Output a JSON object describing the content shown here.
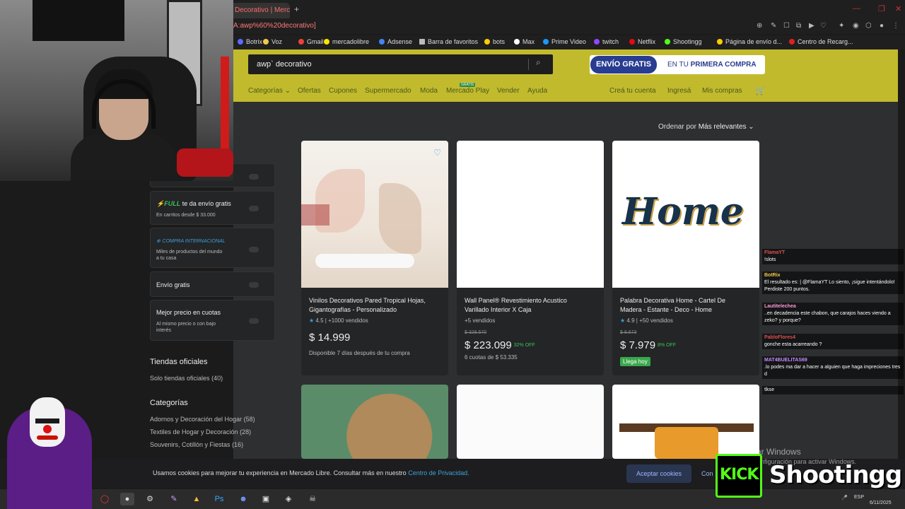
{
  "browser": {
    "tab_title": "Decorativo | Mercado",
    "new_tab": "+",
    "address": "A:awp%60%20decorativo]",
    "bookmarks": [
      {
        "label": "Botrix",
        "color": "#5b6cff"
      },
      {
        "label": "Voz",
        "color": "#f2c94c"
      },
      {
        "label": "Gmail",
        "color": "#ea4335"
      },
      {
        "label": "mercadolibre",
        "color": "#ffe600"
      },
      {
        "label": "Adsense",
        "color": "#4285f4"
      },
      {
        "label": "Barra de favoritos",
        "color": "#bbbbbb"
      },
      {
        "label": "bots",
        "color": "#ffcc00"
      },
      {
        "label": "Max",
        "color": "#ffffff"
      },
      {
        "label": "Prime Video",
        "color": "#1a98ff"
      },
      {
        "label": "twitch",
        "color": "#9146ff"
      },
      {
        "label": "Netflix",
        "color": "#e50914"
      },
      {
        "label": "Shootingg",
        "color": "#53fc18"
      },
      {
        "label": "Página de envío d...",
        "color": "#ffcc00"
      },
      {
        "label": "Centro de Recarg...",
        "color": "#e02020"
      }
    ]
  },
  "ml": {
    "search_value": "awp` decorativo",
    "promo_badge": "ENVÍO GRATIS",
    "promo_text_prefix": "EN TU",
    "promo_text_bold": "PRIMERA COMPRA",
    "nav": {
      "categorias": "Categorías",
      "ofertas": "Ofertas",
      "cupones": "Cupones",
      "supermercado": "Supermercado",
      "moda": "Moda",
      "mercado_play": "Mercado Play",
      "gratis_tag": "GRATIS",
      "vender": "Vender",
      "ayuda": "Ayuda",
      "crea_cuenta": "Creá tu cuenta",
      "ingresa": "Ingresá",
      "mis_compras": "Mis compras"
    },
    "sort_label": "Ordenar por",
    "sort_value": "Más relevantes"
  },
  "sidebar": {
    "full_label": "FULL",
    "full_title": "te da envío gratis",
    "full_sub": "En carritos desde $ 33.000",
    "intl_label": "COMPRA INTERNACIONAL",
    "intl_sub1": "Miles de productos del mundo",
    "intl_sub2": "a tu casa",
    "envio_gratis": "Envío gratis",
    "cuotas_title": "Mejor precio en cuotas",
    "cuotas_sub1": "Al mismo precio o con bajo",
    "cuotas_sub2": "interés",
    "tiendas_heading": "Tiendas oficiales",
    "tiendas_item": "Solo tiendas oficiales",
    "tiendas_count": "(40)",
    "categorias_heading": "Categorías",
    "categorias": [
      {
        "label": "Adornos y Decoración del Hogar",
        "count": "(58)"
      },
      {
        "label": "Textiles de Hogar y Decoración",
        "count": "(28)"
      },
      {
        "label": "Souvenirs, Cotillón y Fiestas",
        "count": "(16)"
      }
    ]
  },
  "products": [
    {
      "title1": "Vinilos Decorativos Pared Tropical Hojas,",
      "title2": "Gigantografías - Personalizado",
      "rating": "4.5",
      "sold": "| +1000 vendidos",
      "price": "$ 14.999",
      "sub": "Disponible 7 días después de tu compra"
    },
    {
      "title1": "Wall Panel® Revestimiento Acustico",
      "title2": "Varillado Interior X Caja",
      "sold": "+5 vendidos",
      "old_price": "$ 328.570",
      "price": "$ 223.099",
      "off": "32% OFF",
      "sub": "6 cuotas de $ 53.335"
    },
    {
      "title1": "Palabra Decorativa Home - Cartel De",
      "title2": "Madera - Estante - Deco - Home",
      "rating": "4.9",
      "sold": "| +50 vendidos",
      "old_price": "$ 8.673",
      "price": "$ 7.979",
      "off": "8% OFF",
      "badge": "Llega hoy",
      "image_word": "Home"
    }
  ],
  "chat": [
    {
      "user": "FlamaYT",
      "text": "!slots",
      "color": "#e05050"
    },
    {
      "user": "BotRix",
      "text": "El resultado es: | @FlamaYT Lo siento, ¡sigue intentándolo! Perdiste 200 puntos.",
      "color": "#f2c94c"
    },
    {
      "user": "Lautitelechea",
      "text": "..en decadencia este chabon, que carajos haces viendo a zeko? y porque?",
      "color": "#ff9ad5"
    },
    {
      "user": "PabloFlores4",
      "text": "gonche esta acarreando ?",
      "color": "#e05050"
    },
    {
      "user": "MAT4BUELITAS69",
      "text": ".lo podes ma dar a hacer a alguien que haga impreciones tres d",
      "color": "#c58cff"
    },
    {
      "user": "tkse",
      "text": "",
      "color": "#cccccc"
    }
  ],
  "cookie": {
    "text": "Usamos cookies para mejorar tu experiencia en Mercado Libre. Consultar más en nuestro",
    "link": "Centro de Privacidad.",
    "accept": "Aceptar cookies",
    "config": "Con"
  },
  "windows": {
    "activate_title": "Activar Windows",
    "activate_sub": "Ve a Configuración para activar Windows.",
    "lang": "ESP",
    "date": "6/11/2025"
  },
  "stream": {
    "platform": "KICK",
    "name": "Shootingg"
  },
  "colors": {
    "ml_yellow": "#c2ba2d",
    "accent_blue": "#3ea0dd",
    "discount_green": "#39c25a",
    "kick_green": "#53fc18"
  }
}
